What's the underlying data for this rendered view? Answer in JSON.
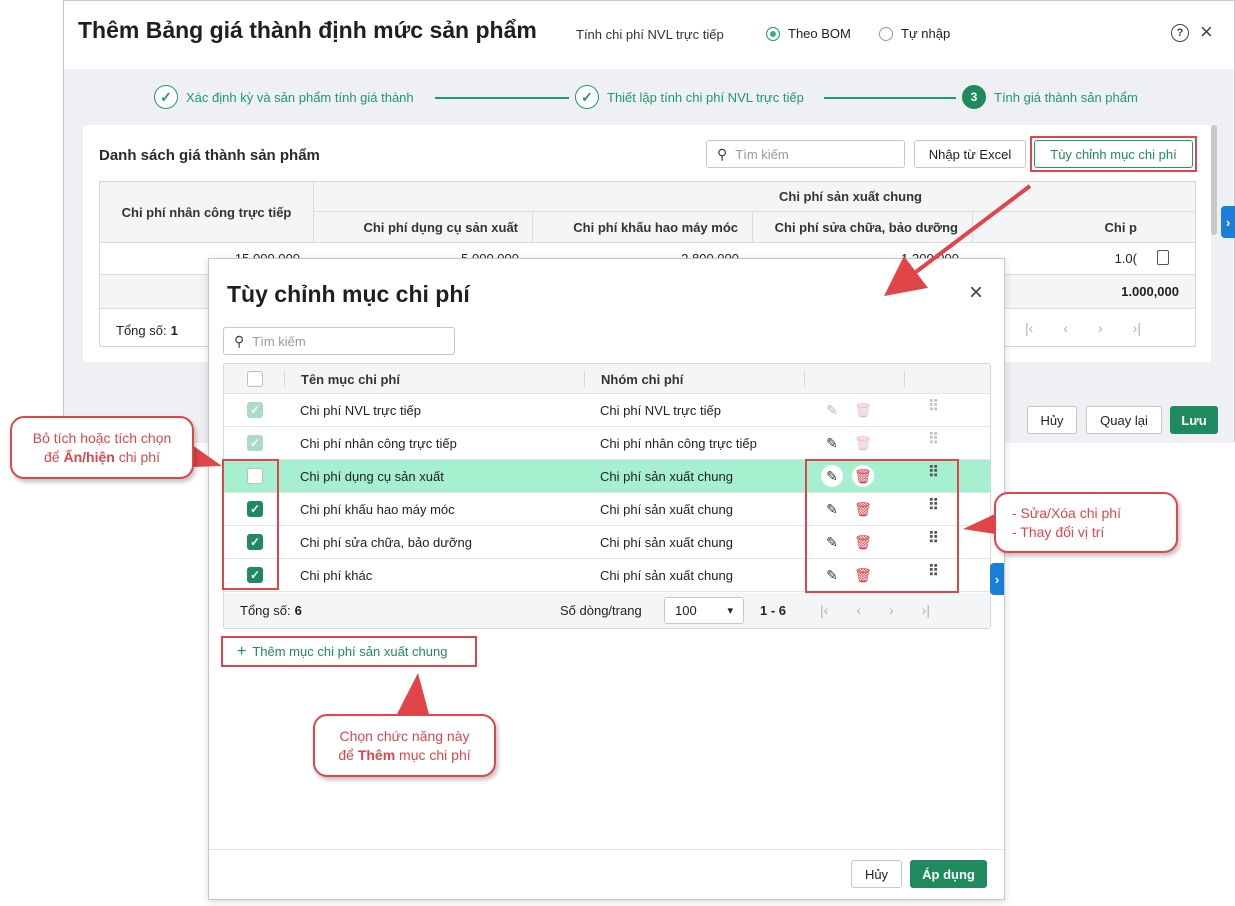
{
  "background_window": {
    "title": "Thêm Bảng giá thành định mức sản phẩm",
    "cost_label": "Tính chi phí NVL trực tiếp",
    "radio_options": [
      {
        "label": "Theo BOM",
        "selected": true
      },
      {
        "label": "Tự nhập",
        "selected": false
      }
    ],
    "steps": [
      {
        "label": "Xác định kỳ và sản phẩm tính giá thành",
        "state": "done"
      },
      {
        "label": "Thiết lập tính chi phí NVL trực tiếp",
        "state": "done"
      },
      {
        "label": "Tính giá thành sản phẩm",
        "state": "active",
        "number": "3"
      }
    ],
    "list_title": "Danh sách giá thành sản phẩm",
    "search_placeholder": "Tìm kiếm",
    "import_button": "Nhập từ Excel",
    "customize_button": "Tùy chỉnh mục chi phí",
    "table": {
      "col_labor": "Chi phí nhân công trực tiếp",
      "group_header": "Chi phí sản xuất chung",
      "sub_cols": [
        "Chi phí dụng cụ sản xuất",
        "Chi phí khấu hao máy móc",
        "Chi phí sửa chữa, bảo dưỡng",
        "Chi p"
      ],
      "row_values": [
        "15.000.000",
        "5.000.000",
        "2.800.000",
        "1.300.000",
        "1.0("
      ],
      "total_value": "1.000,000",
      "total_label": "Tổng số:",
      "total_count": "1"
    },
    "footer_buttons": {
      "cancel": "Hủy",
      "back": "Quay lại",
      "save": "Lưu"
    }
  },
  "modal": {
    "title": "Tùy chỉnh mục chi phí",
    "search_placeholder": "Tìm kiếm",
    "columns": {
      "name": "Tên mục chi phí",
      "group": "Nhóm chi phí"
    },
    "rows": [
      {
        "name": "Chi phí NVL trực tiếp",
        "group": "Chi phí NVL trực tiếp",
        "check": "disabled"
      },
      {
        "name": "Chi phí nhân công trực tiếp",
        "group": "Chi phí nhân công trực tiếp",
        "check": "disabled"
      },
      {
        "name": "Chi phí dụng cụ sản xuất",
        "group": "Chi phí sản xuất chung",
        "check": "off"
      },
      {
        "name": "Chi phí khấu hao máy móc",
        "group": "Chi phí sản xuất chung",
        "check": "on"
      },
      {
        "name": "Chi phí sửa chữa, bảo dưỡng",
        "group": "Chi phí sản xuất chung",
        "check": "on"
      },
      {
        "name": "Chi phí khác",
        "group": "Chi phí sản xuất chung",
        "check": "on"
      }
    ],
    "footer": {
      "total_label": "Tổng số:",
      "total_count": "6",
      "rows_per_page_label": "Số dòng/trang",
      "rows_per_page": "100",
      "range": "1 - 6"
    },
    "add_button": "Thêm mục chi phí sản xuất chung",
    "cancel_button": "Hủy",
    "apply_button": "Áp dụng"
  },
  "callouts": {
    "left_line1": "Bỏ tích hoặc tích chọn",
    "left_line2_prefix": "để ",
    "left_line2_bold": "Ẩn/hiện",
    "left_line2_suffix": " chi phí",
    "right_line1": "- Sửa/Xóa chi phí",
    "right_line2": "- Thay đổi vị trí",
    "bottom_line1": "Chọn chức năng này",
    "bottom_line2_prefix": "để ",
    "bottom_line2_bold": "Thêm",
    "bottom_line2_suffix": " mục chi phí"
  },
  "colors": {
    "accent": "#1e8a5e",
    "highlight_row": "#a6f0cf",
    "annotation_red": "#e0454a"
  }
}
